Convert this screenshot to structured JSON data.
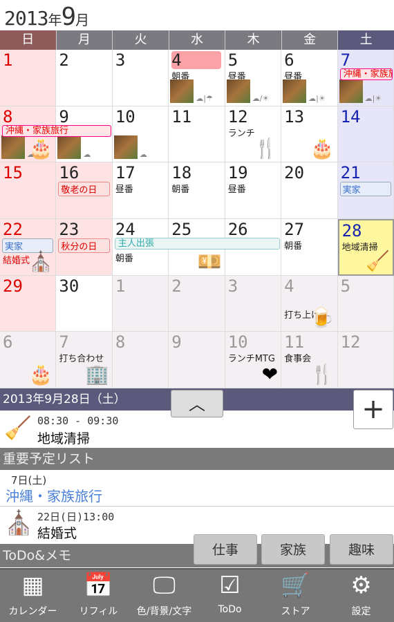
{
  "header": {
    "year": "2013",
    "year_suffix": "年",
    "month": "9",
    "month_suffix": "月"
  },
  "weekdays": [
    "日",
    "月",
    "火",
    "水",
    "木",
    "金",
    "土"
  ],
  "colors": {
    "sunday_header": "#8f5a5a",
    "weekday_header": "#7a7a80",
    "saturday_header": "#5c5a7c",
    "sunday_bg": "#fde3e3",
    "saturday_bg": "#e6e6f8",
    "holiday_bg": "#fde3e3",
    "other_month_bg": "#f4eff3",
    "today_bg": "#fff79e",
    "accent_blue": "#4a80d8"
  },
  "weeks": [
    [
      {
        "d": "1"
      },
      {
        "d": "2"
      },
      {
        "d": "3"
      },
      {
        "d": "4",
        "hl": true,
        "ev": "朝番",
        "photo": true,
        "wx": "☁|☂"
      },
      {
        "d": "5",
        "ev": "昼番",
        "photo": true,
        "wx": "☁/☀"
      },
      {
        "d": "6",
        "ev": "昼番",
        "photo": true,
        "wx": "☁|☀"
      },
      {
        "d": "7",
        "photo": true,
        "wx": "☁|☀"
      }
    ],
    [
      {
        "d": "8",
        "icon": "🎂",
        "photo": true,
        "wx": "☁|☂"
      },
      {
        "d": "9",
        "photo": true,
        "wx": "☁"
      },
      {
        "d": "10",
        "photo": true,
        "wx": "☁"
      },
      {
        "d": "11"
      },
      {
        "d": "12",
        "ev": "ランチ",
        "icon": "🍴"
      },
      {
        "d": "13",
        "icon": "🎂"
      },
      {
        "d": "14"
      }
    ],
    [
      {
        "d": "15"
      },
      {
        "d": "16",
        "hol": "敬老の日",
        "holiday": true
      },
      {
        "d": "17",
        "ev": "昼番"
      },
      {
        "d": "18",
        "ev": "朝番"
      },
      {
        "d": "19",
        "ev": "昼番"
      },
      {
        "d": "20"
      },
      {
        "d": "21",
        "fam": "実家"
      }
    ],
    [
      {
        "d": "22",
        "fam": "実家",
        "red": "結婚式",
        "icon": "⛪"
      },
      {
        "d": "23",
        "hol": "秋分の日",
        "holiday": true
      },
      {
        "d": "24",
        "ev2": "朝番"
      },
      {
        "d": "25",
        "icon": "💴"
      },
      {
        "d": "26"
      },
      {
        "d": "27",
        "ev": "朝番"
      },
      {
        "d": "28",
        "ev": "地域清掃",
        "today": true,
        "icon": "🧹"
      }
    ],
    [
      {
        "d": "29"
      },
      {
        "d": "30"
      },
      {
        "d": "1",
        "other": true
      },
      {
        "d": "2",
        "other": true
      },
      {
        "d": "3",
        "other": true
      },
      {
        "d": "4",
        "other": true,
        "ev2": "打ち上げ",
        "icon": "🍺"
      },
      {
        "d": "5",
        "other": true
      }
    ],
    [
      {
        "d": "6",
        "other": true,
        "icon": "🎂"
      },
      {
        "d": "7",
        "other": true,
        "ev": "打ち合わせ",
        "icon": "🏢"
      },
      {
        "d": "8",
        "other": true
      },
      {
        "d": "9",
        "other": true
      },
      {
        "d": "10",
        "other": true,
        "ev": "ランチMTG",
        "icon": "❤"
      },
      {
        "d": "11",
        "other": true,
        "ev": "食事会",
        "icon": "🍴"
      },
      {
        "d": "12",
        "other": true
      }
    ]
  ],
  "multi_day_events": [
    {
      "label": "沖縄・家族旅行",
      "week": 0,
      "start_day": "7",
      "days": 1,
      "style": "red"
    },
    {
      "label": "沖縄・家族旅行",
      "week": 1,
      "start_day": "8",
      "days": 2,
      "style": "red"
    },
    {
      "label": "主人出張",
      "week": 3,
      "start_day": "24",
      "days": 3,
      "style": "teal"
    }
  ],
  "selected": {
    "date_label": "2013年9月28日（土）",
    "up_label": "︿",
    "add_label": "+",
    "time": "08:30 - 09:30",
    "title": "地域清掃",
    "icon": "broom-icon"
  },
  "important": {
    "title": "重要予定リスト",
    "items": [
      {
        "date": "7日(土)",
        "title": "沖縄・家族旅行"
      },
      {
        "date": "22日(日)13:00",
        "title": "結婚式",
        "icon": "church-icon"
      }
    ]
  },
  "todo": {
    "title": "ToDo&メモ",
    "categories": [
      "仕事",
      "家族",
      "趣味"
    ]
  },
  "nav": [
    {
      "label": "カレンダー",
      "icon": "calendar-icon",
      "g": "▦"
    },
    {
      "label": "リフィル",
      "icon": "refill-icon",
      "g": "📅"
    },
    {
      "label": "色/背景/文字",
      "icon": "monitor-icon",
      "g": "🖵"
    },
    {
      "label": "ToDo",
      "icon": "checkbox-icon",
      "g": "☑"
    },
    {
      "label": "ストア",
      "icon": "cart-icon",
      "g": "🛒"
    },
    {
      "label": "設定",
      "icon": "gear-icon",
      "g": "⚙"
    }
  ]
}
